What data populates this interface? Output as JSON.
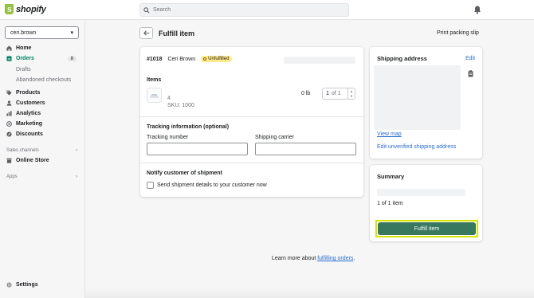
{
  "app": {
    "brand": "shopify",
    "brand_color": "#95bf47",
    "accent_color": "#008060",
    "primary_button_color": "#38785f",
    "highlight_color": "#d4e600"
  },
  "topbar": {
    "search_placeholder": "Search",
    "search_icon": "search-icon",
    "bell_icon": "bell-icon"
  },
  "sidebar": {
    "store_name": "ceri.brown",
    "items": [
      {
        "label": "Home",
        "icon": "home-icon"
      },
      {
        "label": "Orders",
        "icon": "orders-icon",
        "badge": "8",
        "active": true
      },
      {
        "label": "Drafts"
      },
      {
        "label": "Abandoned checkouts"
      },
      {
        "label": "Products",
        "icon": "tag-icon"
      },
      {
        "label": "Customers",
        "icon": "person-icon"
      },
      {
        "label": "Analytics",
        "icon": "bar-chart-icon"
      },
      {
        "label": "Marketing",
        "icon": "target-icon"
      },
      {
        "label": "Discounts",
        "icon": "discount-icon"
      }
    ],
    "sales_channels_label": "Sales channels",
    "online_store_label": "Online Store",
    "apps_label": "Apps",
    "settings_label": "Settings"
  },
  "page": {
    "title": "Fulfill item",
    "print_label": "Print packing slip"
  },
  "order": {
    "number": "#1018",
    "customer": "Ceri Brown",
    "status": "Unfulfilled",
    "items_label": "Items",
    "item": {
      "name": "4",
      "sku": "SKU: 1000",
      "weight": "0 lb",
      "qty": "1",
      "qty_of": "of 1"
    },
    "tracking_label": "Tracking information (optional)",
    "tracking_number_label": "Tracking number",
    "shipping_carrier_label": "Shipping carrier",
    "notify_label": "Notify customer of shipment",
    "notify_checkbox_label": "Send shipment details to your customer now"
  },
  "shipping": {
    "title": "Shipping address",
    "edit_label": "Edit",
    "view_map_label": "View map",
    "edit_unverified_label": "Edit unverified shipping address"
  },
  "summary": {
    "title": "Summary",
    "count_text": "1 of 1 item",
    "fulfill_button": "Fulfill item"
  },
  "footer": {
    "prefix": "Learn more about ",
    "link": "fulfilling orders",
    "suffix": "."
  }
}
